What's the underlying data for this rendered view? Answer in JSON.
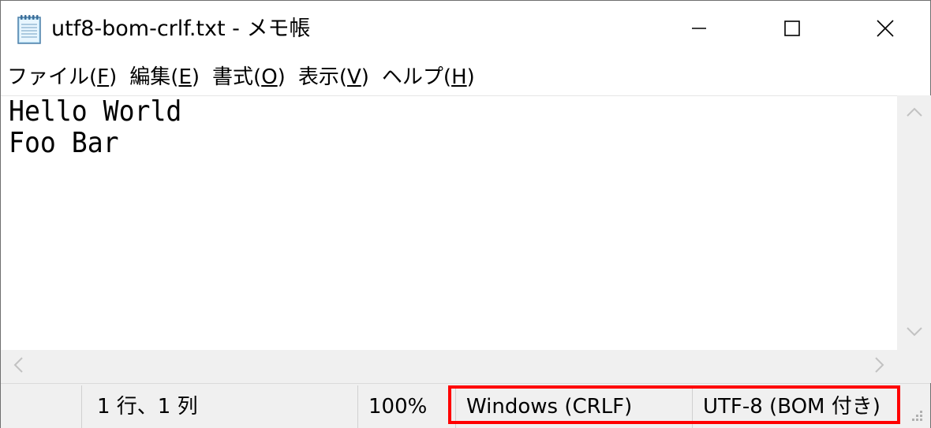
{
  "window": {
    "title": "utf8-bom-crlf.txt - メモ帳",
    "icons": {
      "app": "notepad-icon",
      "minimize": "minimize-icon",
      "maximize": "maximize-icon",
      "close": "close-icon"
    }
  },
  "menu": {
    "items": [
      {
        "label": "ファイル(",
        "accel": "F",
        "suffix": ")"
      },
      {
        "label": "編集(",
        "accel": "E",
        "suffix": ")"
      },
      {
        "label": "書式(",
        "accel": "O",
        "suffix": ")"
      },
      {
        "label": "表示(",
        "accel": "V",
        "suffix": ")"
      },
      {
        "label": "ヘルプ(",
        "accel": "H",
        "suffix": ")"
      }
    ]
  },
  "editor": {
    "lines": [
      "Hello World",
      "Foo Bar"
    ]
  },
  "status": {
    "position": "1 行、1 列",
    "zoom": "100%",
    "line_ending": "Windows (CRLF)",
    "encoding": "UTF-8 (BOM 付き)"
  },
  "colors": {
    "highlight": "#ff0000",
    "chrome": "#f0f0f0"
  }
}
